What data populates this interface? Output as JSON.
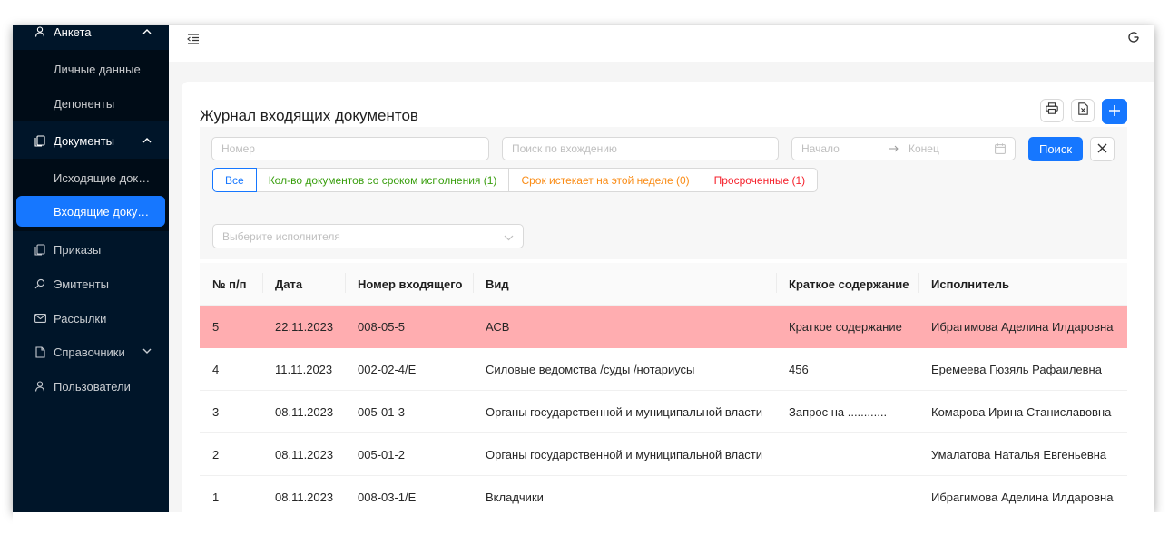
{
  "sidebar": {
    "anketa": "Анкета",
    "personal_data": "Личные данные",
    "deponents": "Депоненты",
    "documents": "Документы",
    "outgoing": "Исходящие документы",
    "incoming": "Входящие документы",
    "orders": "Приказы",
    "emitents": "Эмитенты",
    "mailings": "Рассылки",
    "directories": "Справочники",
    "users": "Пользователи"
  },
  "page": {
    "title": "Журнал входящих документов"
  },
  "filters": {
    "number_placeholder": "Номер",
    "search_placeholder": "Поиск по вхождению",
    "date_start_placeholder": "Начало",
    "date_end_placeholder": "Конец",
    "search_button": "Поиск",
    "executor_placeholder": "Выберите исполнителя",
    "segments": [
      {
        "label": "Все",
        "color": "#1677ff"
      },
      {
        "label": "Кол-во документов со сроком исполнения (1)",
        "color": "#389e0d"
      },
      {
        "label": "Срок истекает на этой неделе (0)",
        "color": "#fa8c16"
      },
      {
        "label": "Просроченные (1)",
        "color": "#f5222d"
      }
    ]
  },
  "table": {
    "columns": [
      "№ п/п",
      "Дата",
      "Номер входящего",
      "Вид",
      "Краткое содержание",
      "Исполнитель"
    ],
    "rows": [
      {
        "n": "5",
        "date": "22.11.2023",
        "number": "008-05-5",
        "kind": "АСВ",
        "summary": "Краткое содержание",
        "executor": "Ибрагимова Аделина Илдаровна",
        "overdue": true
      },
      {
        "n": "4",
        "date": "11.11.2023",
        "number": "002-02-4/Е",
        "kind": "Силовые ведомства /суды /нотариусы",
        "summary": "456",
        "executor": "Еремеева Гюзяль Рафаилевна",
        "overdue": false
      },
      {
        "n": "3",
        "date": "08.11.2023",
        "number": "005-01-3",
        "kind": "Органы государственной и муниципальной власти",
        "summary": "Запрос на ............",
        "executor": "Комарова Ирина Станиславовна",
        "overdue": false
      },
      {
        "n": "2",
        "date": "08.11.2023",
        "number": "005-01-2",
        "kind": "Органы государственной и муниципальной власти",
        "summary": "",
        "executor": "Умалатова Наталья Евгеньевна",
        "overdue": false
      },
      {
        "n": "1",
        "date": "08.11.2023",
        "number": "008-03-1/Е",
        "kind": "Вкладчики",
        "summary": "",
        "executor": "Ибрагимова Аделина Илдаровна",
        "overdue": false
      }
    ]
  },
  "colors": {
    "sidebar_bg": "#001529",
    "accent": "#1677ff",
    "overdue_row": "#ffadb0"
  }
}
